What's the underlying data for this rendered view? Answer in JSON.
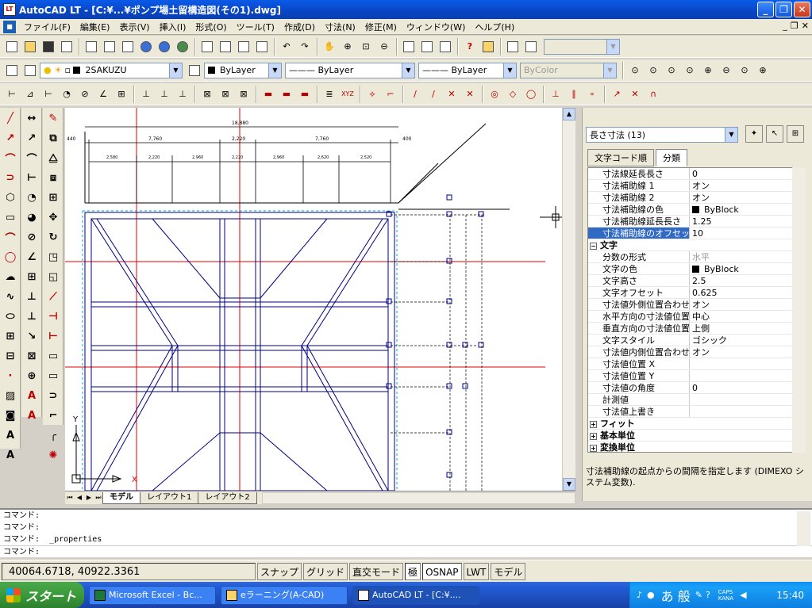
{
  "window": {
    "title": "AutoCAD LT - [C:¥...¥ポンプ場土留構造図(その1).dwg]",
    "app_icon": "LT"
  },
  "menu": {
    "items": [
      "ファイル(F)",
      "編集(E)",
      "表示(V)",
      "挿入(I)",
      "形式(O)",
      "ツール(T)",
      "作成(D)",
      "寸法(N)",
      "修正(M)",
      "ウィンドウ(W)",
      "ヘルプ(H)"
    ]
  },
  "layer_toolbar": {
    "layer_name": "2SAKUZU",
    "color": "ByLayer",
    "linetype": "ByLayer",
    "lineweight": "ByLayer",
    "plotstyle": "ByColor"
  },
  "drawing": {
    "dims_top": [
      "18,880",
      "7,760",
      "2,220",
      "7,760"
    ],
    "dims_side_left": "440",
    "dims_side_right": "400",
    "dims_sub": [
      "2,580",
      "2,220",
      "2,960",
      "2,220",
      "2,960",
      "2,620",
      "2,520"
    ],
    "ucs_label": "Y",
    "ucs_x": "X"
  },
  "layout_tabs": [
    "モデル",
    "レイアウト1",
    "レイアウト2"
  ],
  "properties": {
    "selection": "長さ寸法 (13)",
    "tabs": [
      "文字コード順",
      "分類"
    ],
    "rows": [
      {
        "key": "寸法線延長長さ",
        "value": "0"
      },
      {
        "key": "寸法補助線 1",
        "value": "オン"
      },
      {
        "key": "寸法補助線 2",
        "value": "オン"
      },
      {
        "key": "寸法補助線の色",
        "value": "ByBlock",
        "swatch": true
      },
      {
        "key": "寸法補助線延長長さ",
        "value": "1.25"
      },
      {
        "key": "寸法補助線のオフセット",
        "value": "10",
        "selected": true
      },
      {
        "key": "文字",
        "group": true,
        "expander": "−"
      },
      {
        "key": "分数の形式",
        "value": "水平",
        "dim": true
      },
      {
        "key": "文字の色",
        "value": "ByBlock",
        "swatch": true
      },
      {
        "key": "文字高さ",
        "value": "2.5"
      },
      {
        "key": "文字オフセット",
        "value": "0.625"
      },
      {
        "key": "寸法値外側位置合わせ",
        "value": "オン"
      },
      {
        "key": "水平方向の寸法値位置",
        "value": "中心"
      },
      {
        "key": "垂直方向の寸法値位置",
        "value": "上側"
      },
      {
        "key": "文字スタイル",
        "value": "ゴシック"
      },
      {
        "key": "寸法値内側位置合わせ",
        "value": "オン"
      },
      {
        "key": "寸法値位置 X",
        "value": ""
      },
      {
        "key": "寸法値位置 Y",
        "value": ""
      },
      {
        "key": "寸法値の角度",
        "value": "0"
      },
      {
        "key": "計測値",
        "value": ""
      },
      {
        "key": "寸法値上書き",
        "value": ""
      },
      {
        "key": "フィット",
        "group": true,
        "expander": "+"
      },
      {
        "key": "基本単位",
        "group": true,
        "expander": "+"
      },
      {
        "key": "変換単位",
        "group": true,
        "expander": "+"
      }
    ],
    "description": "寸法補助線の起点からの間隔を指定します (DIMEXO システム変数)."
  },
  "command_line": {
    "lines": [
      "コマンド:",
      "コマンド:",
      "コマンド:  _properties",
      "コマンド:"
    ]
  },
  "status": {
    "coords": "40064.6718, 40922.3361",
    "buttons": [
      "スナップ",
      "グリッド",
      "直交モード",
      "極",
      "OSNAP",
      "LWT",
      "モデル"
    ]
  },
  "taskbar": {
    "start": "スタート",
    "tasks": [
      "Microsoft Excel - Bc...",
      "eラーニング(A-CAD)",
      "AutoCAD LT - [C:¥...."
    ],
    "tray_ime": "あ 般",
    "tray_caps": "CAPS",
    "tray_kana": "KANA",
    "clock": "15:40"
  }
}
